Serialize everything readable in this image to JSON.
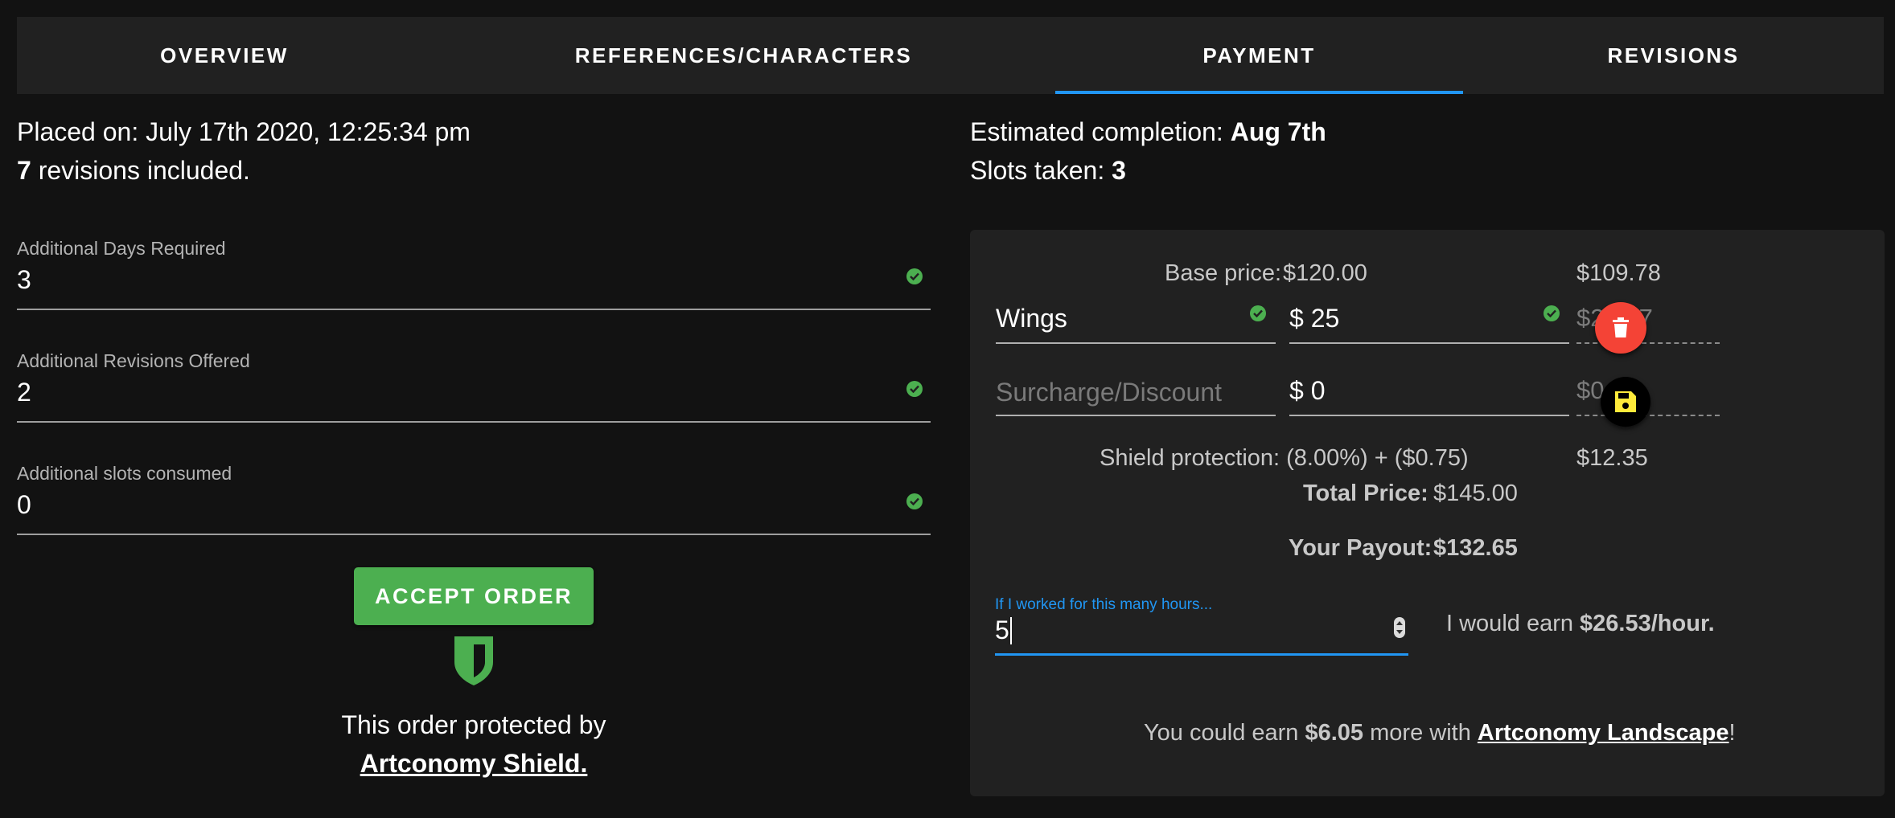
{
  "tabs": [
    {
      "label": "OVERVIEW"
    },
    {
      "label": "REFERENCES/CHARACTERS"
    },
    {
      "label": "PAYMENT",
      "active": true
    },
    {
      "label": "REVISIONS"
    }
  ],
  "order": {
    "placed_on": "Placed on: July 17th 2020, 12:25:34 pm",
    "revisions_count": "7",
    "revisions_text": " revisions included.",
    "estimated_label": "Estimated completion: ",
    "estimated_value": "Aug 7th",
    "slots_label": "Slots taken: ",
    "slots_value": "3"
  },
  "fields": {
    "days": {
      "label": "Additional Days Required",
      "value": "3"
    },
    "revisions": {
      "label": "Additional Revisions Offered",
      "value": "2"
    },
    "slots": {
      "label": "Additional slots consumed",
      "value": "0"
    }
  },
  "accept_button": "ACCEPT ORDER",
  "protection": {
    "text": "This order protected by",
    "link": "Artconomy Shield."
  },
  "pricing": {
    "base_label": "Base price:",
    "base_value": "$120.00",
    "base_net": "$109.78",
    "line_item_name": "Wings",
    "line_item_amount": "$ 25",
    "line_item_net": "$22.87",
    "surcharge_placeholder": "Surcharge/Discount",
    "surcharge_amount": "$ 0",
    "surcharge_net": "$0.00",
    "shield_label": "Shield protection: (8.00%) + ($0.75)",
    "shield_value": "$12.35",
    "total_label": "Total Price:",
    "total_value": "$145.00",
    "payout_label": "Your Payout:",
    "payout_value": "$132.65"
  },
  "hours": {
    "label": "If I worked for this many hours...",
    "value": "5",
    "earn_prefix": "I would earn ",
    "earn_value": "$26.53/hour."
  },
  "upsell": {
    "prefix": "You could earn ",
    "amount": "$6.05",
    "middle": " more with ",
    "link": "Artconomy Landscape",
    "suffix": "!"
  },
  "colors": {
    "background": "#121212",
    "surface": "#212121",
    "accent_blue": "#2196f3",
    "success_green": "#4caf50",
    "delete_red": "#f44336",
    "save_yellow": "#ffeb3b"
  },
  "icons": [
    "check-circle-icon",
    "trash-icon",
    "floppy-disk-icon",
    "shield-icon"
  ]
}
